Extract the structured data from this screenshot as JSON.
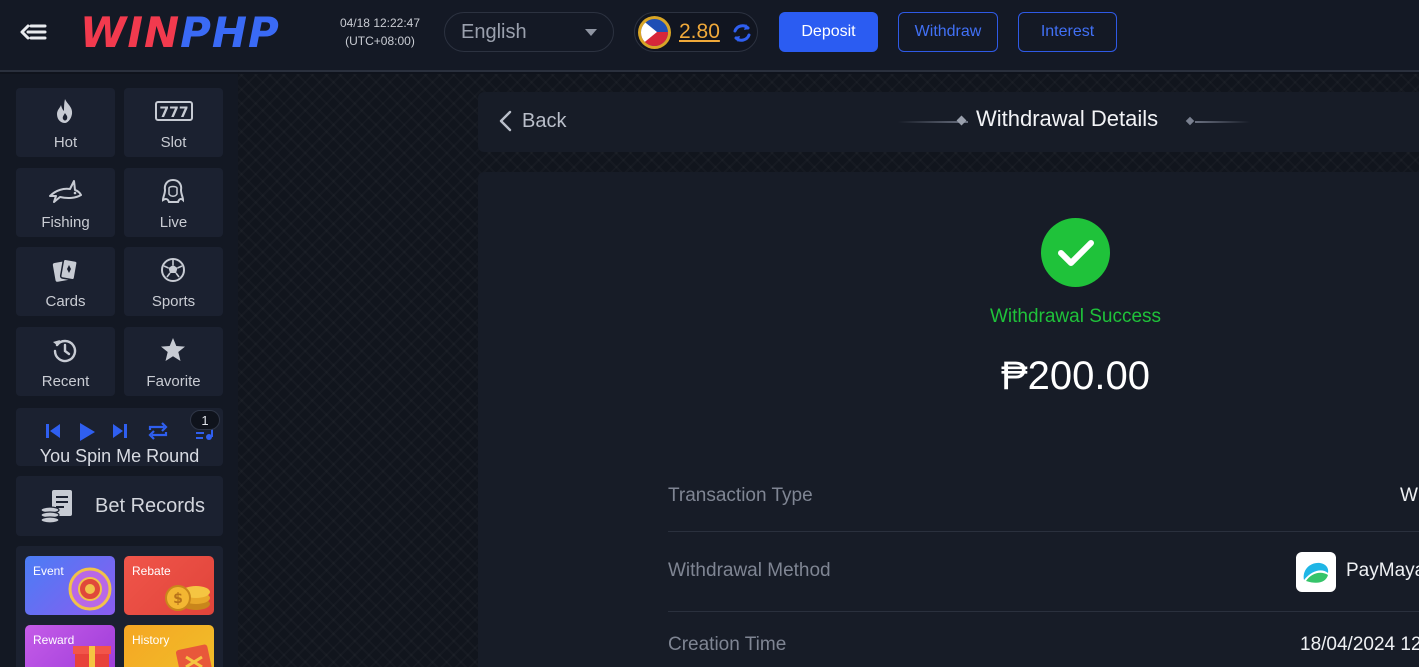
{
  "header": {
    "logo": {
      "win": "WIN",
      "php": "PHP"
    },
    "clock": {
      "date_time": "04/18 12:22:47",
      "timezone": "(UTC+08:00)"
    },
    "language": {
      "selected": "English"
    },
    "balance": {
      "amount": "2.80",
      "currency_flag": "philippines-flag-icon"
    },
    "buttons": {
      "deposit": "Deposit",
      "withdraw": "Withdraw",
      "interest": "Interest"
    }
  },
  "sidebar": {
    "categories": [
      {
        "label": "Hot",
        "icon": "flame-icon"
      },
      {
        "label": "Slot",
        "icon": "slot-777-icon"
      },
      {
        "label": "Fishing",
        "icon": "shark-icon"
      },
      {
        "label": "Live",
        "icon": "live-dealer-icon"
      },
      {
        "label": "Cards",
        "icon": "cards-icon"
      },
      {
        "label": "Sports",
        "icon": "soccer-ball-icon"
      },
      {
        "label": "Recent",
        "icon": "history-icon"
      },
      {
        "label": "Favorite",
        "icon": "star-icon"
      }
    ],
    "player": {
      "song": "You Spin Me Round",
      "queue_count": "1"
    },
    "bet_records": {
      "label": "Bet Records"
    },
    "promos": [
      {
        "label": "Event"
      },
      {
        "label": "Rebate"
      },
      {
        "label": "Reward"
      },
      {
        "label": "History"
      }
    ]
  },
  "main": {
    "back_label": "Back",
    "title": "Withdrawal Details",
    "status": "Withdrawal Success",
    "amount": "₱200.00",
    "details": [
      {
        "key": "Transaction Type",
        "value": "W"
      },
      {
        "key": "Withdrawal Method",
        "value": "PayMaya"
      },
      {
        "key": "Creation Time",
        "value": "18/04/2024 12"
      }
    ]
  },
  "colors": {
    "accent": "#2b5cf2",
    "success": "#1fc23a",
    "balance": "#f0a93a",
    "logo_red": "#f23a4e",
    "logo_blue": "#3a6af5"
  }
}
